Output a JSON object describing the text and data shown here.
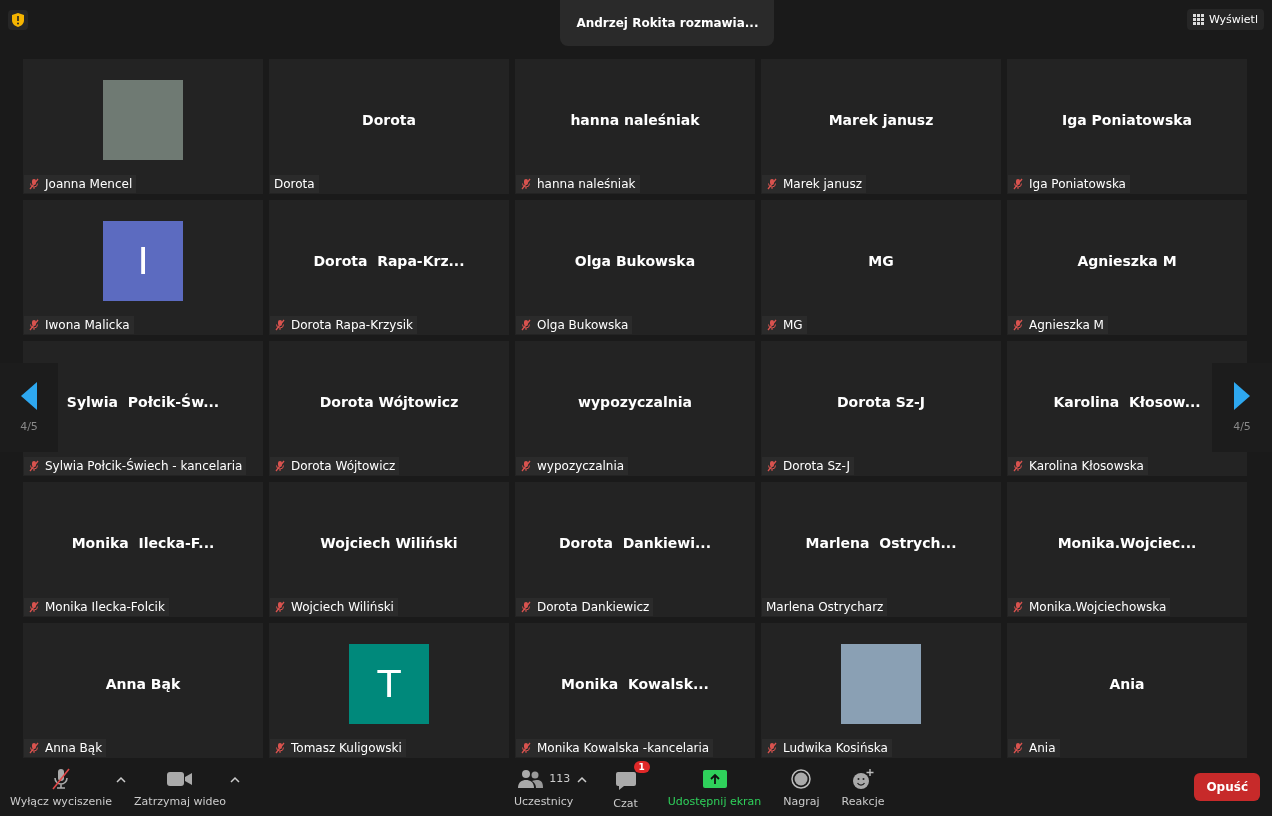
{
  "top_bar": {
    "speaker_banner": "Andrzej Rokita rozmawia...",
    "view_button": "Wyświetl"
  },
  "pager": {
    "previous_label": "4/5",
    "next_label": "4/5"
  },
  "tiles": [
    {
      "kind": "photo",
      "name": "Joanna Mencel",
      "muted": true
    },
    {
      "kind": "name",
      "display": "Dorota",
      "name": "Dorota",
      "muted": false
    },
    {
      "kind": "name",
      "display": "hanna naleśniak",
      "name": "hanna naleśniak",
      "muted": true
    },
    {
      "kind": "name",
      "display": "Marek janusz",
      "name": "Marek janusz",
      "muted": true
    },
    {
      "kind": "name",
      "display": "Iga Poniatowska",
      "name": "Iga Poniatowska",
      "muted": true
    },
    {
      "kind": "avatar",
      "display": "I",
      "color": "#5c6bc0",
      "name": "Iwona Malicka",
      "muted": true
    },
    {
      "kind": "name",
      "display": "Dorota  Rapa-Krz...",
      "name": "Dorota Rapa-Krzysik",
      "muted": true
    },
    {
      "kind": "name",
      "display": "Olga Bukowska",
      "name": "Olga Bukowska",
      "muted": true
    },
    {
      "kind": "name",
      "display": "MG",
      "name": "MG",
      "muted": true
    },
    {
      "kind": "name",
      "display": "Agnieszka M",
      "name": "Agnieszka M",
      "muted": true
    },
    {
      "kind": "name",
      "display": "Sylwia  Połcik-Św...",
      "name": "Sylwia Połcik-Świech - kancelaria",
      "muted": true
    },
    {
      "kind": "name",
      "display": "Dorota Wójtowicz",
      "name": "Dorota Wójtowicz",
      "muted": true
    },
    {
      "kind": "name",
      "display": "wypozyczalnia",
      "name": "wypozyczalnia",
      "muted": true
    },
    {
      "kind": "name",
      "display": "Dorota Sz-J",
      "name": "Dorota Sz-J",
      "muted": true
    },
    {
      "kind": "name",
      "display": "Karolina  Kłosow...",
      "name": "Karolina Kłosowska",
      "muted": true
    },
    {
      "kind": "name",
      "display": "Monika  Ilecka-F...",
      "name": "Monika Ilecka-Folcik",
      "muted": true
    },
    {
      "kind": "name",
      "display": "Wojciech Wiliński",
      "name": "Wojciech Wiliński",
      "muted": true
    },
    {
      "kind": "name",
      "display": "Dorota  Dankiewi...",
      "name": "Dorota Dankiewicz",
      "muted": true
    },
    {
      "kind": "name",
      "display": "Marlena  Ostrych...",
      "name": "Marlena Ostrycharz",
      "muted": false
    },
    {
      "kind": "name",
      "display": "Monika.Wojciec...",
      "name": "Monika.Wojciechowska",
      "muted": true
    },
    {
      "kind": "name",
      "display": "Anna Bąk",
      "name": "Anna Bąk",
      "muted": true
    },
    {
      "kind": "avatar",
      "display": "T",
      "color": "#00897b",
      "name": "Tomasz Kuligowski",
      "muted": true
    },
    {
      "kind": "name",
      "display": "Monika  Kowalsk...",
      "name": "Monika Kowalska -kancelaria",
      "muted": true
    },
    {
      "kind": "photo",
      "name": "Ludwika Kosińska",
      "muted": true
    },
    {
      "kind": "name",
      "display": "Ania",
      "name": "Ania",
      "muted": true
    }
  ],
  "toolbar": {
    "left": [
      {
        "kind": "mic",
        "label": "Wyłącz wyciszenie",
        "muted": true,
        "has_menu": true
      },
      {
        "kind": "video",
        "label": "Zatrzymaj wideo",
        "has_menu": true
      }
    ],
    "center": [
      {
        "kind": "participants",
        "label": "Uczestnicy",
        "count": "113",
        "has_menu": true
      },
      {
        "kind": "chat",
        "label": "Czat",
        "badge": "1"
      },
      {
        "kind": "share",
        "label": "Udostępnij ekran"
      },
      {
        "kind": "record",
        "label": "Nagraj"
      },
      {
        "kind": "reactions",
        "label": "Reakcje"
      }
    ],
    "leave_button": "Opuść"
  }
}
